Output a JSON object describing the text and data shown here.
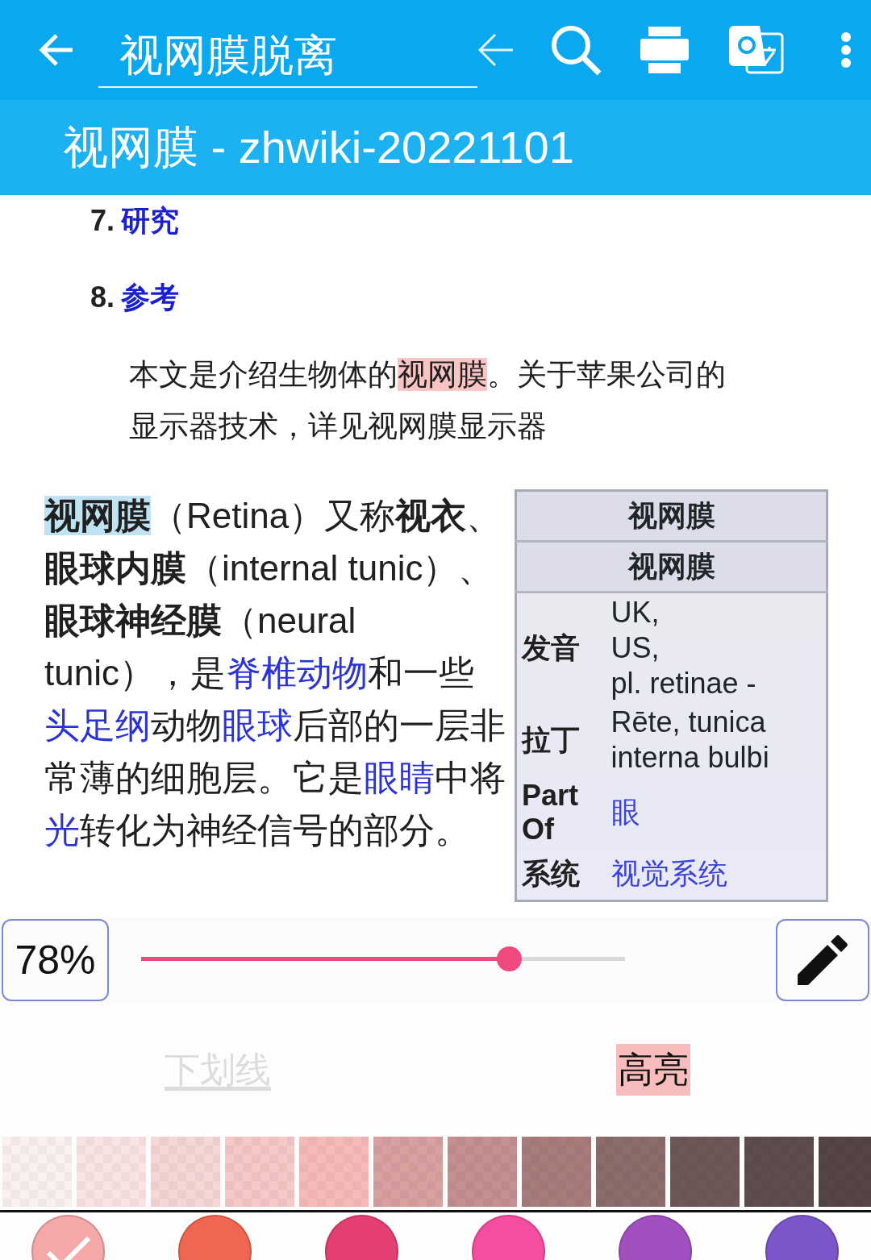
{
  "toolbar": {
    "search": {
      "value": "视网膜脱离"
    }
  },
  "page_title": "视网膜 - zhwiki-20221101",
  "toc": [
    {
      "number": "7.",
      "label": "研究"
    },
    {
      "number": "8.",
      "label": "参考"
    }
  ],
  "hatnote": [
    {
      "kind": "plain",
      "text": "本文是介绍生物体的"
    },
    {
      "kind": "highlight",
      "text": "视网膜",
      "color": "#f8c4c4"
    },
    {
      "kind": "plain",
      "text": "。关于苹果公司的显示器技术，详见视网膜显示器"
    }
  ],
  "paragraph": [
    {
      "kind": "highlight",
      "text": "视网膜",
      "color": "#bfe3f2"
    },
    {
      "kind": "plain",
      "text": "（Retina）又称"
    },
    {
      "kind": "bold",
      "text": "视衣"
    },
    {
      "kind": "plain",
      "text": "、"
    },
    {
      "kind": "bold",
      "text": "眼球内膜"
    },
    {
      "kind": "plain",
      "text": "（internal tunic）、"
    },
    {
      "kind": "bold",
      "text": "眼球神经膜"
    },
    {
      "kind": "plain",
      "text": "（neural tunic），是"
    },
    {
      "kind": "link",
      "text": "脊椎动物"
    },
    {
      "kind": "plain",
      "text": "和一些"
    },
    {
      "kind": "link",
      "text": "头足纲"
    },
    {
      "kind": "plain",
      "text": "动物"
    },
    {
      "kind": "link",
      "text": "眼球"
    },
    {
      "kind": "plain",
      "text": "后部的一层非常薄的细胞层。它是"
    },
    {
      "kind": "link",
      "text": "眼睛"
    },
    {
      "kind": "plain",
      "text": "中将"
    },
    {
      "kind": "link",
      "text": "光"
    },
    {
      "kind": "plain",
      "text": "转化为神经信号的部分。"
    }
  ],
  "infobox": {
    "title": "视网膜",
    "subtitle": "视网膜",
    "rows": [
      {
        "label": "发音",
        "kind": "text",
        "values": [
          "UK,",
          "US,",
          "pl. retinae -"
        ]
      },
      {
        "label": "拉丁",
        "kind": "text",
        "values": [
          "Rēte, tunica interna bulbi"
        ]
      },
      {
        "label": "Part Of",
        "kind": "link",
        "values": [
          "眼"
        ]
      },
      {
        "label": "系统",
        "kind": "link",
        "values": [
          "视觉系统"
        ]
      }
    ]
  },
  "annotation_panel": {
    "opacity_button": "78%",
    "opacity_slider": {
      "level": 0.76
    },
    "styles": [
      {
        "label": "下划线",
        "selected": false
      },
      {
        "label": "高亮",
        "selected": true
      }
    ],
    "shades": [
      {
        "color": "#fbf0f0"
      },
      {
        "color": "#f9e4e4"
      },
      {
        "color": "#f7d6d6"
      },
      {
        "color": "#f6c8c8"
      },
      {
        "color": "#f7baba"
      },
      {
        "color": "#d9a0a0"
      },
      {
        "color": "#c49090"
      },
      {
        "color": "#a97c7c"
      },
      {
        "color": "#8d6c6c"
      },
      {
        "color": "#6d5858"
      },
      {
        "color": "#5f4d4d"
      },
      {
        "color": "#554545"
      }
    ],
    "colors": [
      {
        "color": "#f6a7a7",
        "selected": true
      },
      {
        "color": "#ef6652",
        "selected": false
      },
      {
        "color": "#e43f72",
        "selected": false
      },
      {
        "color": "#f54d9f",
        "selected": false
      },
      {
        "color": "#a24fbf",
        "selected": false
      },
      {
        "color": "#7b56c9",
        "selected": false
      }
    ]
  }
}
